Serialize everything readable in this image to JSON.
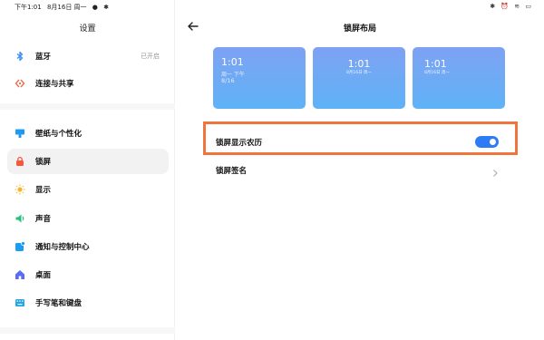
{
  "status_bar": {
    "time": "下午1:01",
    "date": "8月16日 周一",
    "right_icons": [
      "bluetooth-icon",
      "alarm-icon",
      "wifi-icon",
      "battery-icon"
    ]
  },
  "sidebar": {
    "title": "设置",
    "items": [
      {
        "label": "蓝牙",
        "value": "已开启",
        "icon": "bluetooth-icon",
        "color": "#3b8cf7"
      },
      {
        "label": "连接与共享",
        "value": "",
        "icon": "share-icon",
        "color": "#f36c4d"
      },
      {
        "label": "壁纸与个性化",
        "value": "",
        "icon": "wallpaper-icon",
        "color": "#1e9bf0"
      },
      {
        "label": "锁屏",
        "value": "",
        "icon": "lock-icon",
        "color": "#f5593d",
        "active": true
      },
      {
        "label": "显示",
        "value": "",
        "icon": "sun-icon",
        "color": "#f8b52a"
      },
      {
        "label": "声音",
        "value": "",
        "icon": "speaker-icon",
        "color": "#27c07d"
      },
      {
        "label": "通知与控制中心",
        "value": "",
        "icon": "notification-icon",
        "color": "#1d9df2"
      },
      {
        "label": "桌面",
        "value": "",
        "icon": "home-icon",
        "color": "#5a6cf3"
      },
      {
        "label": "手写笔和键盘",
        "value": "",
        "icon": "keyboard-icon",
        "color": "#22a7e6"
      }
    ]
  },
  "main": {
    "title": "锁屏布局",
    "previews": [
      {
        "time": "1:01",
        "sub": "周一 下午",
        "date": "8/16"
      },
      {
        "time": "1:01",
        "sub": "8月16日 周一"
      },
      {
        "time": "1:01",
        "sub": "8月16日 周一"
      }
    ],
    "rows": [
      {
        "label": "锁屏显示农历",
        "type": "toggle",
        "on": true
      },
      {
        "label": "锁屏签名",
        "type": "link"
      }
    ]
  },
  "colors": {
    "accent": "#2f7bf5",
    "highlight": "#f0753d",
    "preview_top": "#7ea2f3",
    "preview_bottom": "#5fb2f6"
  }
}
